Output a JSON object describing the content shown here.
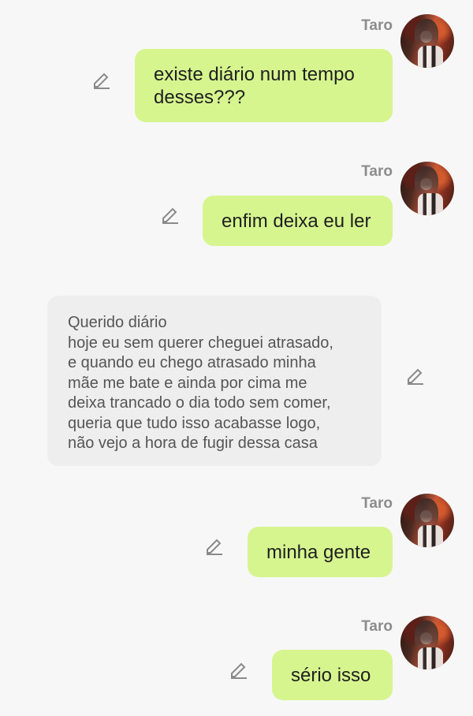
{
  "messages": [
    {
      "sender": "Taro",
      "side": "right",
      "text": "existe diário num tempo desses???"
    },
    {
      "sender": "Taro",
      "side": "right",
      "text": "enfim deixa eu ler"
    },
    {
      "sender": "",
      "side": "left",
      "lines": [
        "Querido diário",
        "hoje eu sem querer cheguei atrasado,",
        "e quando eu chego atrasado minha",
        "mãe me bate e ainda por cima me",
        "deixa trancado o dia todo sem comer,",
        "queria que tudo isso acabasse logo,",
        "não vejo a hora de fugir dessa casa"
      ]
    },
    {
      "sender": "Taro",
      "side": "right",
      "text": "minha gente"
    },
    {
      "sender": "Taro",
      "side": "right",
      "text": "sério isso"
    }
  ],
  "colors": {
    "right_bubble": "#d6f58f",
    "left_bubble": "#eeeeee",
    "background": "#f7f7f7"
  },
  "icons": {
    "edit": "pencil-icon",
    "avatar": "avatar"
  }
}
